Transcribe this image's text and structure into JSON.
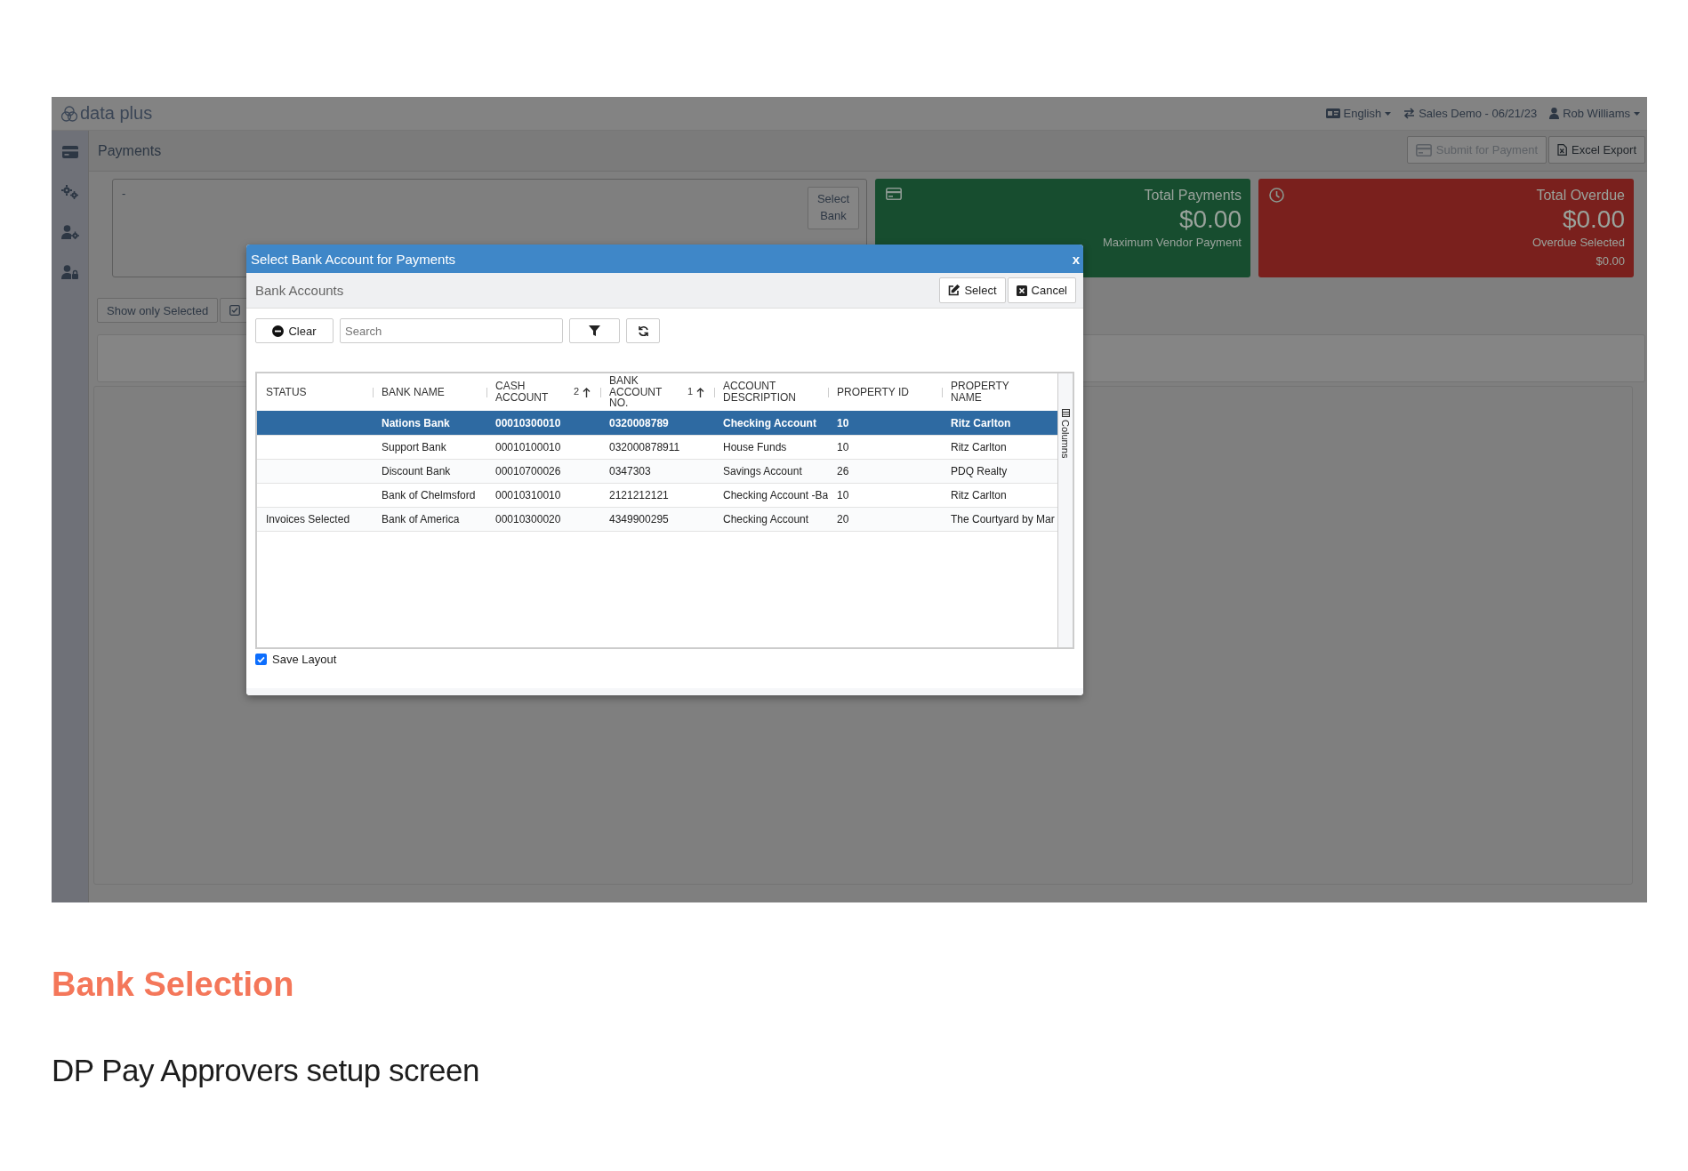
{
  "app": {
    "logo": "data plus",
    "top_menu": [
      {
        "kind": "language",
        "label": "English",
        "dropdown": true
      },
      {
        "kind": "switch",
        "label": "Sales Demo - 06/21/23",
        "dropdown": false
      },
      {
        "kind": "user",
        "label": "Rob Williams",
        "dropdown": true
      }
    ],
    "sidebar": {
      "items": [
        {
          "kind": "card"
        },
        {
          "kind": "gears"
        },
        {
          "kind": "user-gear"
        },
        {
          "kind": "user-lock"
        }
      ]
    },
    "page_title": "Payments",
    "toolbar": [
      {
        "kind": "card",
        "label": "Submit for Payment",
        "disabled": true
      },
      {
        "kind": "excel",
        "label": "Excel Export",
        "disabled": false
      }
    ],
    "bank_panel": {
      "value": "-",
      "button": "Select Bank"
    },
    "cards": [
      {
        "kind": "payments",
        "title": "Total Payments",
        "amount": "$0.00",
        "subtitle": "Maximum Vendor Payment",
        "color": "#174d2f"
      },
      {
        "kind": "overdue",
        "title": "Total Overdue",
        "amount": "$0.00",
        "subtitle": "Overdue Selected",
        "note": "$0.00",
        "color": "#7a201d"
      }
    ],
    "filter_buttons": [
      {
        "kind": "text",
        "label": "Show only Selected"
      },
      {
        "kind": "checkbox"
      }
    ]
  },
  "dialog": {
    "title": "Select Bank Account for Payments",
    "close": "x",
    "section": "Bank Accounts",
    "actions": [
      {
        "kind": "edit",
        "label": "Select"
      },
      {
        "kind": "cancel",
        "label": "Cancel"
      }
    ],
    "clear": "Clear",
    "search": {
      "placeholder": "Search"
    },
    "table": {
      "columns": [
        {
          "label": "STATUS"
        },
        {
          "label": "BANK NAME"
        },
        {
          "label": "CASH ACCOUNT",
          "sort_order": "2"
        },
        {
          "label": "BANK ACCOUNT NO.",
          "sort_order": "1"
        },
        {
          "label": "ACCOUNT DESCRIPTION"
        },
        {
          "label": "PROPERTY ID"
        },
        {
          "label": "PROPERTY NAME"
        }
      ],
      "rows": [
        {
          "selected": true,
          "bank_name": "Nations Bank",
          "cash_account": "00010300010",
          "bank_account_no": "0320008789",
          "account_description": "Checking Account",
          "property_id": "10",
          "property_name": "Ritz Carlton"
        },
        {
          "selected": false,
          "bank_name": "Support Bank",
          "cash_account": "00010100010",
          "bank_account_no": "032000878911",
          "account_description": "House Funds",
          "property_id": "10",
          "property_name": "Ritz Carlton"
        },
        {
          "selected": false,
          "bank_name": "Discount Bank",
          "cash_account": "00010700026",
          "bank_account_no": "0347303",
          "account_description": "Savings Account",
          "property_id": "26",
          "property_name": "PDQ Realty"
        },
        {
          "selected": false,
          "bank_name": "Bank of Chelmsford",
          "cash_account": "00010310010",
          "bank_account_no": "2121212121",
          "account_description": "Checking Account -Ba",
          "property_id": "10",
          "property_name": "Ritz Carlton"
        },
        {
          "selected": false,
          "status": "Invoices Selected",
          "bank_name": "Bank of America",
          "cash_account": "00010300020",
          "bank_account_no": "4349900295",
          "account_description": "Checking Account",
          "property_id": "20",
          "property_name": "The Courtyard by Mar"
        }
      ]
    },
    "side_tab": "Columns",
    "save_layout": {
      "label": "Save Layout",
      "checked": true
    }
  },
  "caption": {
    "heading": "Bank Selection",
    "subheading": "DP Pay Approvers setup screen"
  }
}
